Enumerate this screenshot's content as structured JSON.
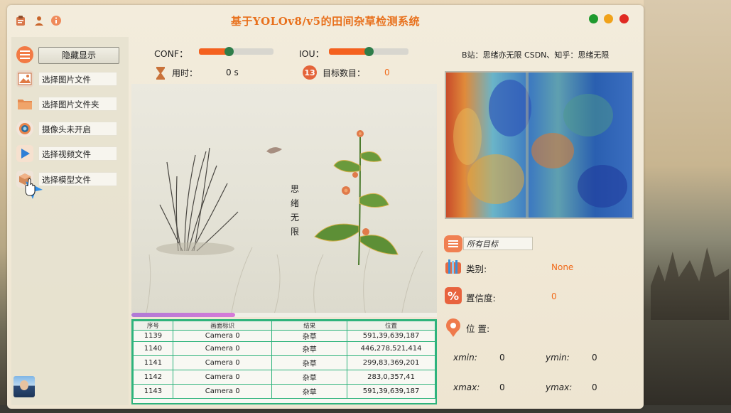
{
  "window": {
    "title": "基于YOLOv8/v5的田间杂草检测系统",
    "title_icons": [
      "clipboard-icon",
      "person-icon",
      "info-icon"
    ],
    "controls": [
      "minimize-dot",
      "maximize-dot",
      "close-dot"
    ],
    "control_colors": [
      "#1f9a2e",
      "#f0a21a",
      "#e02a22"
    ]
  },
  "sidebar": {
    "hide_button": "隐藏显示",
    "items": [
      {
        "label": "选择图片文件",
        "icon": "image-file-icon"
      },
      {
        "label": "选择图片文件夹",
        "icon": "folder-icon"
      },
      {
        "label": "摄像头未开启",
        "icon": "camera-icon"
      },
      {
        "label": "选择视频文件",
        "icon": "video-play-icon"
      },
      {
        "label": "选择模型文件",
        "icon": "model-cube-icon"
      }
    ]
  },
  "controls": {
    "conf_label": "CONF：",
    "conf_value": 0.25,
    "iou_label": "IOU：",
    "iou_value": 0.5,
    "time_label": "用时：",
    "time_value": "0 s",
    "count_label": "目标数目：",
    "count_value": "0"
  },
  "canvas": {
    "poem_text": "思绪无限"
  },
  "progress": 0.34,
  "table": {
    "headers": [
      "序号",
      "画面标识",
      "结果",
      "位置"
    ],
    "rows": [
      [
        "1139",
        "Camera 0",
        "杂草",
        "591,39,639,187"
      ],
      [
        "1140",
        "Camera 0",
        "杂草",
        "446,278,521,414"
      ],
      [
        "1141",
        "Camera 0",
        "杂草",
        "299,83,369,201"
      ],
      [
        "1142",
        "Camera 0",
        "杂草",
        "283,0,357,41"
      ],
      [
        "1143",
        "Camera 0",
        "杂草",
        "591,39,639,187"
      ]
    ]
  },
  "right": {
    "source_text": "B站：思绪亦无限  CSDN、知乎：思绪无限",
    "target_select": "所有目标",
    "class_label": "类别:",
    "class_value": "None",
    "confidence_label": "置信度:",
    "confidence_value": "0",
    "position_label": "位 置:",
    "xmin_label": "xmin:",
    "xmin_value": "0",
    "ymin_label": "ymin:",
    "ymin_value": "0",
    "xmax_label": "xmax:",
    "xmax_value": "0",
    "ymax_label": "ymax:",
    "ymax_value": "0"
  },
  "colors": {
    "accent": "#f4611f",
    "title": "#e8701c",
    "table_border": "#2eb37c",
    "knob": "#2e7d4a"
  }
}
